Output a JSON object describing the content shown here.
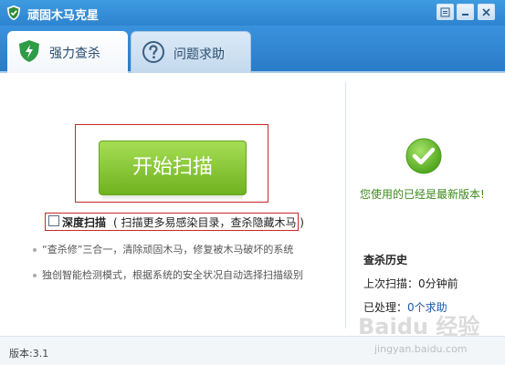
{
  "window": {
    "title": "顽固木马克星",
    "controls": [
      "menu-icon",
      "minimize-icon",
      "close-icon"
    ]
  },
  "tabs": [
    {
      "label": "强力查杀",
      "icon": "shield-icon",
      "active": true
    },
    {
      "label": "问题求助",
      "icon": "help-icon",
      "active": false
    }
  ],
  "scan": {
    "button_label": "开始扫描",
    "deep_scan_label": "深度扫描",
    "deep_scan_desc": "( 扫描更多易感染目录，查杀隐藏木马 )",
    "deep_scan_checked": false
  },
  "features": [
    "“查杀修”三合一，清除顽固木马，修复被木马破坏的系统",
    "独创智能检测模式，根据系统的安全状况自动选择扫描级别"
  ],
  "status": {
    "icon": "check-icon",
    "text": "您使用的已经是最新版本!"
  },
  "history": {
    "title": "查杀历史",
    "last_scan_label": "上次扫描：",
    "last_scan_value": "0分钟前",
    "processed_label": "已处理：",
    "processed_link": "0个求助"
  },
  "footer": {
    "version": "版本:3.1"
  },
  "watermark": {
    "logo": "Baidu 经验",
    "url": "jingyan.baidu.com"
  },
  "colors": {
    "titlebar": "#2d83cf",
    "scan_button": "#7ec132",
    "highlight_frame": "#c62828",
    "status_green": "#3a8a1a"
  }
}
